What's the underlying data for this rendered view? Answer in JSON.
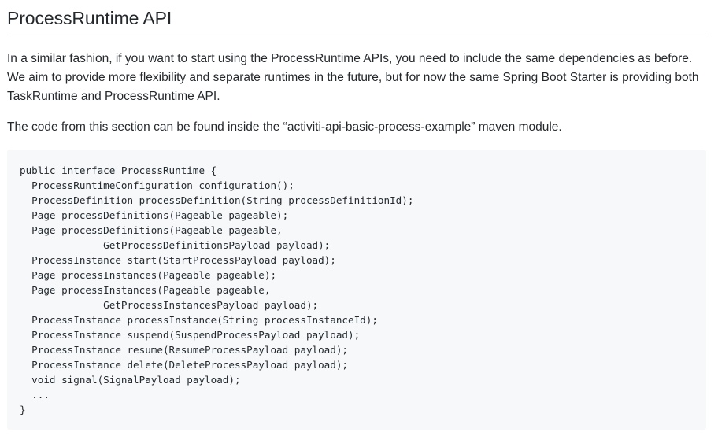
{
  "section": {
    "title": "ProcessRuntime API",
    "paragraphs": [
      "In a similar fashion, if you want to start using the ProcessRuntime APIs, you need to include the same dependencies as before. We aim to provide more flexibility and separate runtimes in the future, but for now the same Spring Boot Starter is providing both TaskRuntime and ProcessRuntime API.",
      "The code from this section can be found inside the “activiti-api-basic-process-example” maven module."
    ],
    "code_lines": [
      "public interface ProcessRuntime {",
      "  ProcessRuntimeConfiguration configuration();",
      "  ProcessDefinition processDefinition(String processDefinitionId);",
      "  Page processDefinitions(Pageable pageable);",
      "  Page processDefinitions(Pageable pageable,",
      "              GetProcessDefinitionsPayload payload);",
      "  ProcessInstance start(StartProcessPayload payload);",
      "  Page processInstances(Pageable pageable);",
      "  Page processInstances(Pageable pageable,",
      "              GetProcessInstancesPayload payload);",
      "  ProcessInstance processInstance(String processInstanceId);",
      "  ProcessInstance suspend(SuspendProcessPayload payload);",
      "  ProcessInstance resume(ResumeProcessPayload payload);",
      "  ProcessInstance delete(DeleteProcessPayload payload);",
      "  void signal(SignalPayload payload);",
      "  ...",
      "}"
    ]
  }
}
